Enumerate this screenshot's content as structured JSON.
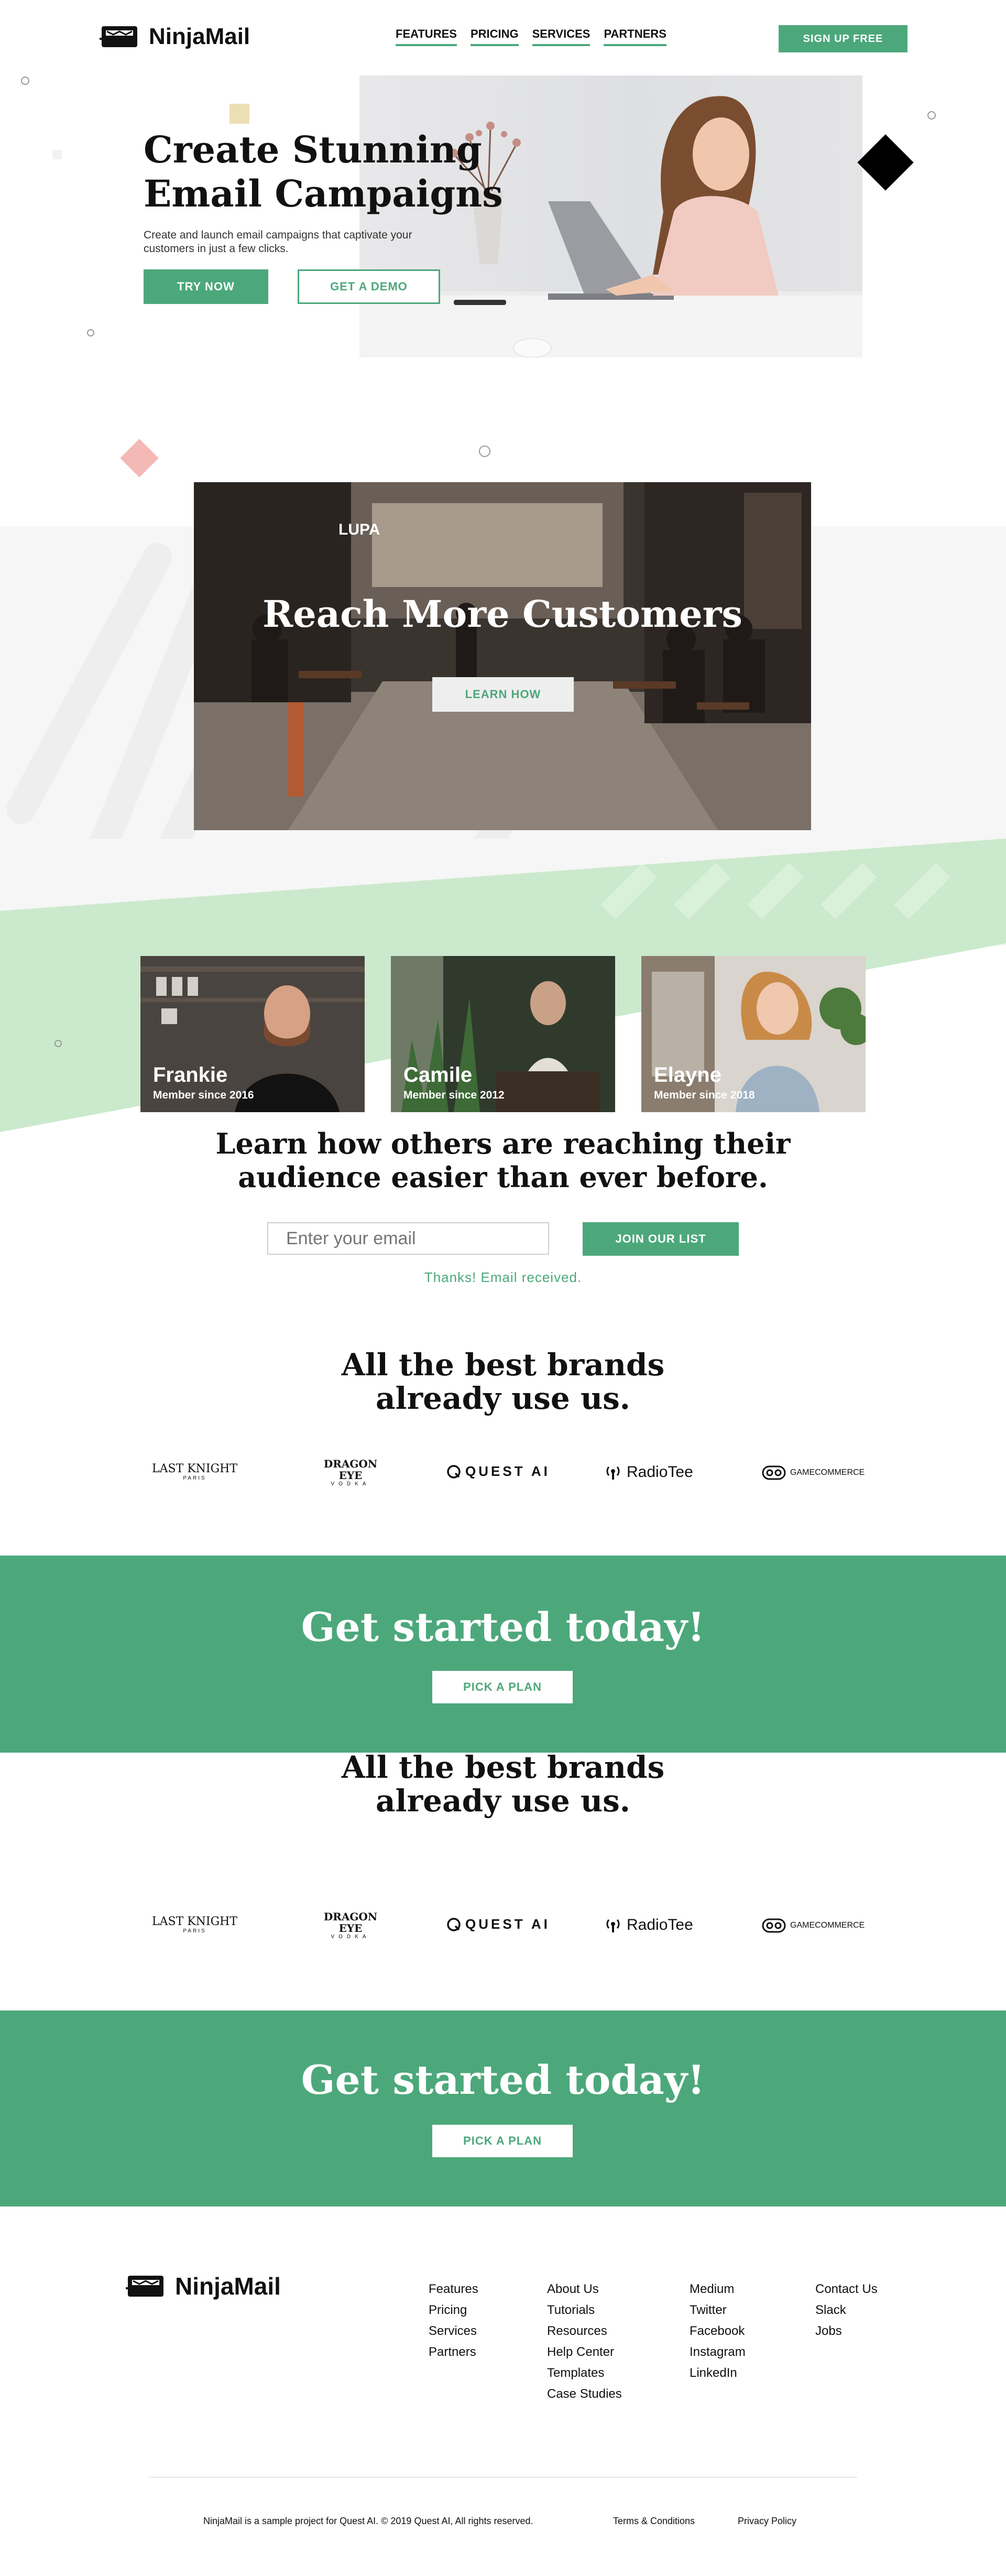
{
  "header": {
    "logo_text": "NinjaMail",
    "nav": [
      "FEATURES",
      "PRICING",
      "SERVICES",
      "PARTNERS"
    ],
    "signup_label": "SIGN UP FREE"
  },
  "hero": {
    "title_line1": "Create Stunning",
    "title_line2": "Email Campaigns",
    "subtitle_line1": "Create and launch email campaigns that captivate your",
    "subtitle_line2": "customers in just a few clicks.",
    "try_label": "TRY NOW",
    "demo_label": "GET A DEMO"
  },
  "reach": {
    "title": "Reach More Customers",
    "learn_label": "LEARN HOW",
    "sign_text": "LUPA"
  },
  "members": [
    {
      "name": "Frankie",
      "since": "Member since 2016"
    },
    {
      "name": "Camile",
      "since": "Member since 2012"
    },
    {
      "name": "Elayne",
      "since": "Member since 2018"
    }
  ],
  "signup": {
    "title_line1": "Learn how others are reaching their",
    "title_line2": "audience easier than ever before.",
    "placeholder": "Enter your email",
    "join_label": "JOIN OUR LIST",
    "confirmation": "Thanks! Email received."
  },
  "brands_section": {
    "title_line1": "All the best brands",
    "title_line2": "already use us.",
    "logos": [
      {
        "main": "LAST KNIGHT",
        "sub": "PARIS"
      },
      {
        "main": "DRAGON EYE",
        "sub": "VODKA"
      },
      {
        "main": "QUEST AI",
        "sub": ""
      },
      {
        "main": "RadioTee",
        "sub": ""
      },
      {
        "main": "GAMECOMMERCE",
        "sub": ""
      }
    ]
  },
  "cta": {
    "title": "Get started today!",
    "button_label": "PICK A PLAN"
  },
  "footer": {
    "logo_text": "NinjaMail",
    "columns": [
      [
        "Features",
        "Pricing",
        "Services",
        "Partners"
      ],
      [
        "About Us",
        "Tutorials",
        "Resources",
        "Help Center",
        "Templates",
        "Case Studies"
      ],
      [
        "Medium",
        "Twitter",
        "Facebook",
        "Instagram",
        "LinkedIn"
      ],
      [
        "Contact Us",
        "Slack",
        "Jobs"
      ]
    ],
    "copyright": "NinjaMail is a sample project for Quest AI. © 2019 Quest AI, All rights reserved.",
    "terms": "Terms & Conditions",
    "privacy": "Privacy Policy"
  },
  "colors": {
    "accent": "#4ca87b",
    "light_green": "#cbe9cc",
    "pink": "#f4b8b5",
    "gold": "#ecdfb4"
  }
}
